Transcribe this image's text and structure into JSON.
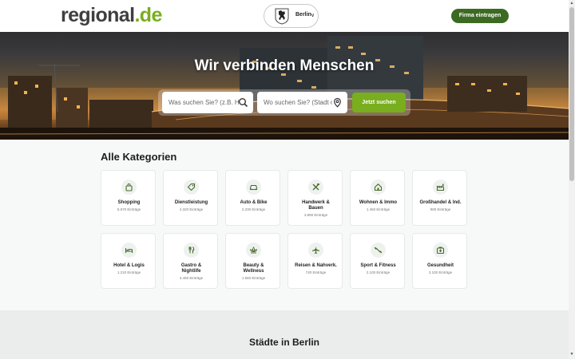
{
  "header": {
    "logo_main": "regional",
    "logo_tld": ".de",
    "city_selector": {
      "label": "Berlin",
      "chevron": "∨"
    },
    "cta_label": "Firma eintragen"
  },
  "hero": {
    "title": "Wir verbinden Menschen",
    "search": {
      "what_placeholder": "Was suchen Sie? (z.B. Handwerker, Restaurant)",
      "where_placeholder": "Wo suchen Sie? (Stadt oder PLZ)",
      "submit_label": "Jetzt suchen"
    }
  },
  "categories": {
    "title": "Alle Kategorien",
    "items": [
      {
        "name": "Shopping",
        "count": "5.670 Einträge",
        "icon": "shopping-bag-icon"
      },
      {
        "name": "Dienstleistung",
        "count": "4.320 Einträge",
        "icon": "tag-icon"
      },
      {
        "name": "Auto & Bike",
        "count": "2.230 Einträge",
        "icon": "car-icon"
      },
      {
        "name": "Handwerk & Bauen",
        "count": "3.890 Einträge",
        "icon": "tools-icon"
      },
      {
        "name": "Wohnen & Immo",
        "count": "1.450 Einträge",
        "icon": "house-icon"
      },
      {
        "name": "Großhandel & Ind.",
        "count": "980 Einträge",
        "icon": "factory-icon"
      },
      {
        "name": "Hotel & Logis",
        "count": "1.210 Einträge",
        "icon": "bed-icon"
      },
      {
        "name": "Gastro & Nightlife",
        "count": "3.450 Einträge",
        "icon": "cutlery-icon"
      },
      {
        "name": "Beauty & Wellness",
        "count": "1.560 Einträge",
        "icon": "lotus-icon"
      },
      {
        "name": "Reisen & Nahverk.",
        "count": "740 Einträge",
        "icon": "plane-icon"
      },
      {
        "name": "Sport & Fitness",
        "count": "2.100 Einträge",
        "icon": "dumbbell-icon"
      },
      {
        "name": "Gesundheit",
        "count": "3.100 Einträge",
        "icon": "medical-kit-icon"
      }
    ]
  },
  "cities": {
    "title": "Städte in Berlin"
  },
  "colors": {
    "brand_green": "#79ae1e",
    "dark_green": "#3c6a23",
    "logo_gray": "#3f3f3f"
  }
}
